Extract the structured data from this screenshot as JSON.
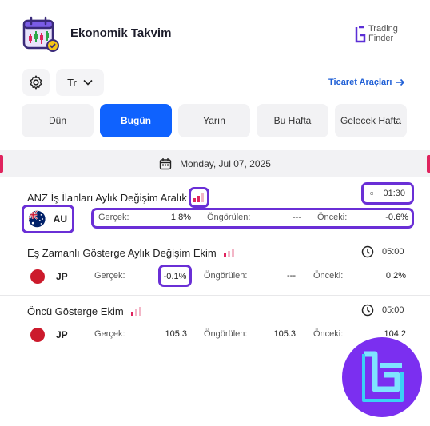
{
  "header": {
    "title": "Ekonomik Takvim",
    "brand_line1": "Trading",
    "brand_line2": "Finder"
  },
  "controls": {
    "language": "Tr",
    "tools_link": "Ticaret Araçları"
  },
  "tabs": [
    {
      "label": "Dün",
      "active": false
    },
    {
      "label": "Bugün",
      "active": true
    },
    {
      "label": "Yarın",
      "active": false
    },
    {
      "label": "Bu Hafta",
      "active": false
    },
    {
      "label": "Gelecek Hafta",
      "active": false
    }
  ],
  "date": "Monday, Jul 07, 2025",
  "labels": {
    "actual": "Gerçek:",
    "forecast": "Öngörülen:",
    "previous": "Önceki:"
  },
  "events": [
    {
      "title": "ANZ İş İlanları Aylık Değişim Aralık",
      "time": "01:30",
      "country": "AU",
      "actual": "1.8%",
      "forecast": "---",
      "previous": "-0.6%"
    },
    {
      "title": "Eş Zamanlı Gösterge Aylık Değişim Ekim",
      "time": "05:00",
      "country": "JP",
      "actual": "-0.1%",
      "forecast": "---",
      "previous": "0.2%"
    },
    {
      "title": "Öncü Gösterge Ekim",
      "time": "05:00",
      "country": "JP",
      "actual": "105.3",
      "forecast": "105.3",
      "previous": "104.2"
    }
  ],
  "colors": {
    "accent": "#0f62fe",
    "highlight": "#6a2fd6",
    "impact": "#e0245e",
    "jp_flag": "#cc1a2c"
  }
}
